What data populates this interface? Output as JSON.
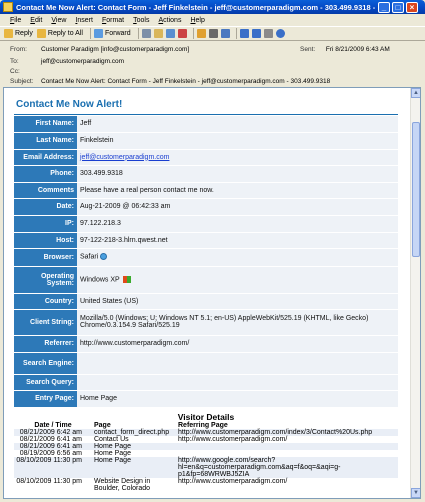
{
  "window": {
    "title": "Contact Me Now Alert: Contact Form - Jeff Finkelstein - jeff@customerparadigm.com - 303.499.9318 - Message (HTM..."
  },
  "menu": [
    "File",
    "Edit",
    "View",
    "Insert",
    "Format",
    "Tools",
    "Actions",
    "Help"
  ],
  "toolbar": {
    "reply": "Reply",
    "reply_all": "Reply to All",
    "forward": "Forward"
  },
  "header": {
    "from_label": "From:",
    "from_value": "Customer Paradigm [info@customerparadigm.com]",
    "sent_label": "Sent:",
    "sent_value": "Fri 8/21/2009 6:43 AM",
    "to_label": "To:",
    "to_value": "jeff@customerparadigm.com",
    "cc_label": "Cc:",
    "cc_value": "",
    "subject_label": "Subject:",
    "subject_value": "Contact Me Now Alert: Contact Form - Jeff Finkelstein - jeff@customerparadigm.com - 303.499.9318"
  },
  "body": {
    "form_title": "Contact Me Now Alert!",
    "fields": [
      {
        "key": "First Name:",
        "value": "Jeff"
      },
      {
        "key": "Last Name:",
        "value": "Finkelstein"
      },
      {
        "key": "Email Address:",
        "value": "jeff@customerparadigm.com"
      },
      {
        "key": "Phone:",
        "value": "303.499.9318"
      },
      {
        "key": "Comments",
        "value": "Please have a real person contact me now."
      },
      {
        "key": "Date:",
        "value": "Aug-21-2009 @ 06:42:33 am"
      },
      {
        "key": "IP:",
        "value": "97.122.218.3"
      },
      {
        "key": "Host:",
        "value": "97-122-218-3.hlrn.qwest.net"
      },
      {
        "key": "Browser:",
        "value": "Safari"
      },
      {
        "key": "Operating System:",
        "value": "Windows XP"
      },
      {
        "key": "Country:",
        "value": "United States (US)"
      },
      {
        "key": "Client String:",
        "value": "Mozilla/5.0 (Windows; U; Windows NT 5.1; en-US) AppleWebKit/525.19 (KHTML, like Gecko) Chrome/0.3.154.9 Safari/525.19"
      },
      {
        "key": "Referrer:",
        "value": "http://www.customerparadigm.com/"
      },
      {
        "key": "Search Engine:",
        "value": ""
      },
      {
        "key": "Search Query:",
        "value": ""
      },
      {
        "key": "Entry Page:",
        "value": "Home Page"
      }
    ],
    "visitor_title": "Visitor Details",
    "visit_headers": [
      "Date / Time",
      "Page",
      "Referring Page"
    ],
    "visits": [
      {
        "date": "08/21/2009 6:42 am",
        "page": "contact_form_direct.php",
        "ref": "http://www.customerparadigm.com/index/3/Contact%20Us.php"
      },
      {
        "date": "08/21/2009 6:41 am",
        "page": "Contact Us",
        "ref": "http://www.customerparadigm.com/"
      },
      {
        "date": "08/21/2009 6:41 am",
        "page": "Home Page",
        "ref": ""
      },
      {
        "date": "08/19/2009 6:56 am",
        "page": "Home Page",
        "ref": ""
      },
      {
        "date": "08/10/2009 11:30 pm",
        "page": "Home Page",
        "ref": "http://www.google.com/search?hl=en&q=customerparadigm.com&aq=f&oq=&aqi=g-p1&fp=68WRWBJ5ZIA"
      },
      {
        "date": "08/10/2009 11:30 pm",
        "page": "Website Design in Boulder, Colorado",
        "ref": "http://www.customerparadigm.com/"
      }
    ]
  }
}
